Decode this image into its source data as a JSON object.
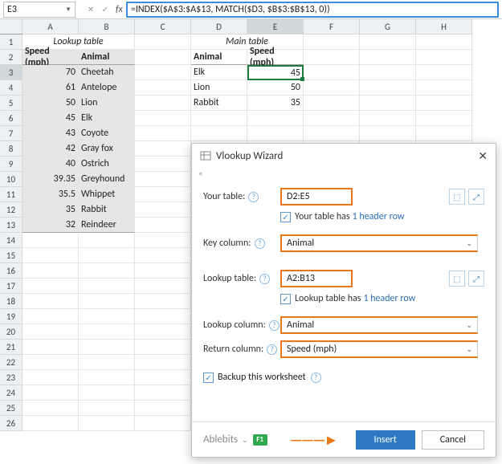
{
  "namebox": "E3",
  "formula": "=INDEX($A$3:$A$13, MATCH($D3, $B$3:$B$13, 0))",
  "columns": [
    "A",
    "B",
    "C",
    "D",
    "E",
    "F",
    "G",
    "H"
  ],
  "rows": [
    "1",
    "2",
    "3",
    "4",
    "5",
    "6",
    "7",
    "8",
    "9",
    "10",
    "11",
    "12",
    "13",
    "14",
    "15",
    "16",
    "17",
    "18",
    "19",
    "20",
    "21",
    "22",
    "23",
    "24",
    "25",
    "26"
  ],
  "lookup_title": "Lookup table",
  "main_title": "Main table",
  "hdr_speed": "Speed (mph)",
  "hdr_animal": "Animal",
  "lookup_rows": [
    {
      "speed": "70",
      "animal": "Cheetah"
    },
    {
      "speed": "61",
      "animal": "Antelope"
    },
    {
      "speed": "50",
      "animal": "Lion"
    },
    {
      "speed": "45",
      "animal": "Elk"
    },
    {
      "speed": "43",
      "animal": "Coyote"
    },
    {
      "speed": "42",
      "animal": "Gray fox"
    },
    {
      "speed": "40",
      "animal": "Ostrich"
    },
    {
      "speed": "39.35",
      "animal": "Greyhound"
    },
    {
      "speed": "35.5",
      "animal": "Whippet"
    },
    {
      "speed": "35",
      "animal": "Rabbit"
    },
    {
      "speed": "32",
      "animal": "Reindeer"
    }
  ],
  "main_rows": [
    {
      "animal": "Elk",
      "speed": "45"
    },
    {
      "animal": "Lion",
      "speed": "50"
    },
    {
      "animal": "Rabbit",
      "speed": "35"
    }
  ],
  "dlg": {
    "title": "Vlookup Wizard",
    "your_table_lbl": "Your table:",
    "your_table_val": "D2:E5",
    "your_table_note": "Your table has",
    "one_header": "1 header row",
    "key_col_lbl": "Key column:",
    "key_col_val": "Animal",
    "lookup_table_lbl": "Lookup table:",
    "lookup_table_val": "A2:B13",
    "lookup_table_note": "Lookup table has",
    "lookup_col_lbl": "Lookup column:",
    "lookup_col_val": "Animal",
    "return_col_lbl": "Return column:",
    "return_col_val": "Speed (mph)",
    "backup_lbl": "Backup this worksheet",
    "brand": "Ablebits",
    "f1": "F1",
    "insert": "Insert",
    "cancel": "Cancel"
  }
}
